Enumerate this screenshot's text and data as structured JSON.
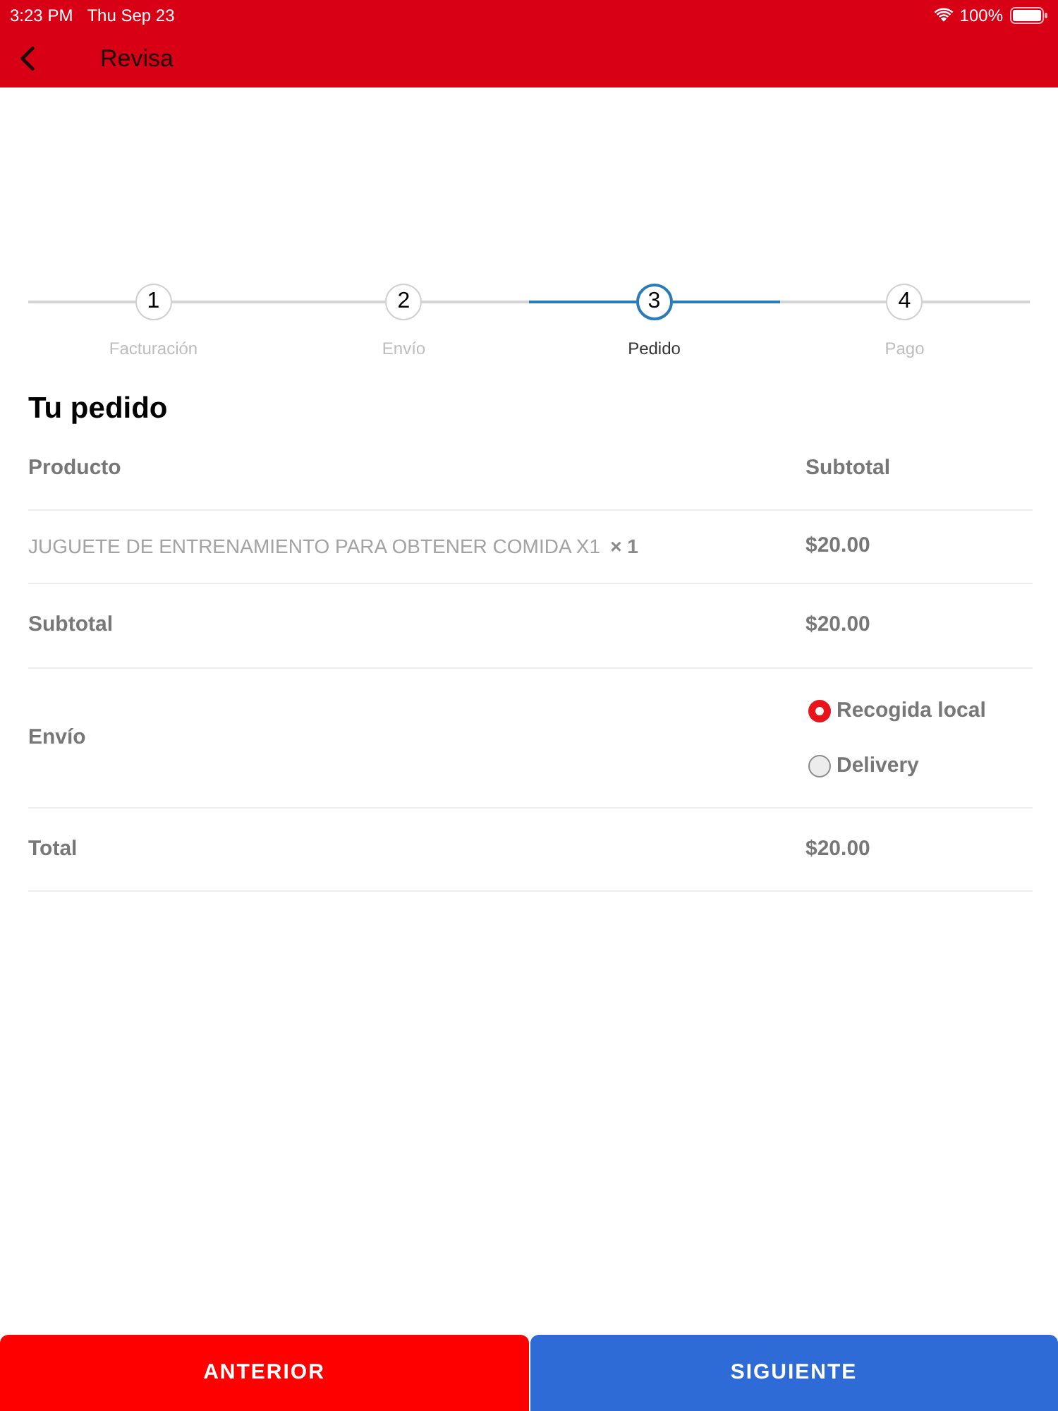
{
  "status_bar": {
    "time": "3:23 PM",
    "date": "Thu Sep 23",
    "battery": "100%"
  },
  "header": {
    "title": "Revisa"
  },
  "steps": [
    {
      "number": "1",
      "label": "Facturación",
      "selected": false
    },
    {
      "number": "2",
      "label": "Envío",
      "selected": false
    },
    {
      "number": "3",
      "label": "Pedido",
      "selected": true
    },
    {
      "number": "4",
      "label": "Pago",
      "selected": false
    }
  ],
  "order": {
    "title": "Tu pedido",
    "columns": [
      "Producto",
      "Subtotal"
    ],
    "items": [
      {
        "name": "JUGUETE DE ENTRENAMIENTO PARA OBTENER COMIDA X1",
        "quantity": "× 1",
        "price": "$20.00"
      }
    ],
    "subtotal": {
      "label": "Subtotal",
      "value": "$20.00"
    },
    "shipping": {
      "label": "Envío",
      "options": [
        {
          "label": "Recogida local",
          "selected": true
        },
        {
          "label": "Delivery",
          "selected": false
        }
      ]
    },
    "total": {
      "label": "Total",
      "value": "$20.00"
    }
  },
  "buttons": [
    {
      "label": "ANTERIOR",
      "kind": "back"
    },
    {
      "label": "SIGUIENTE",
      "kind": "next"
    }
  ]
}
